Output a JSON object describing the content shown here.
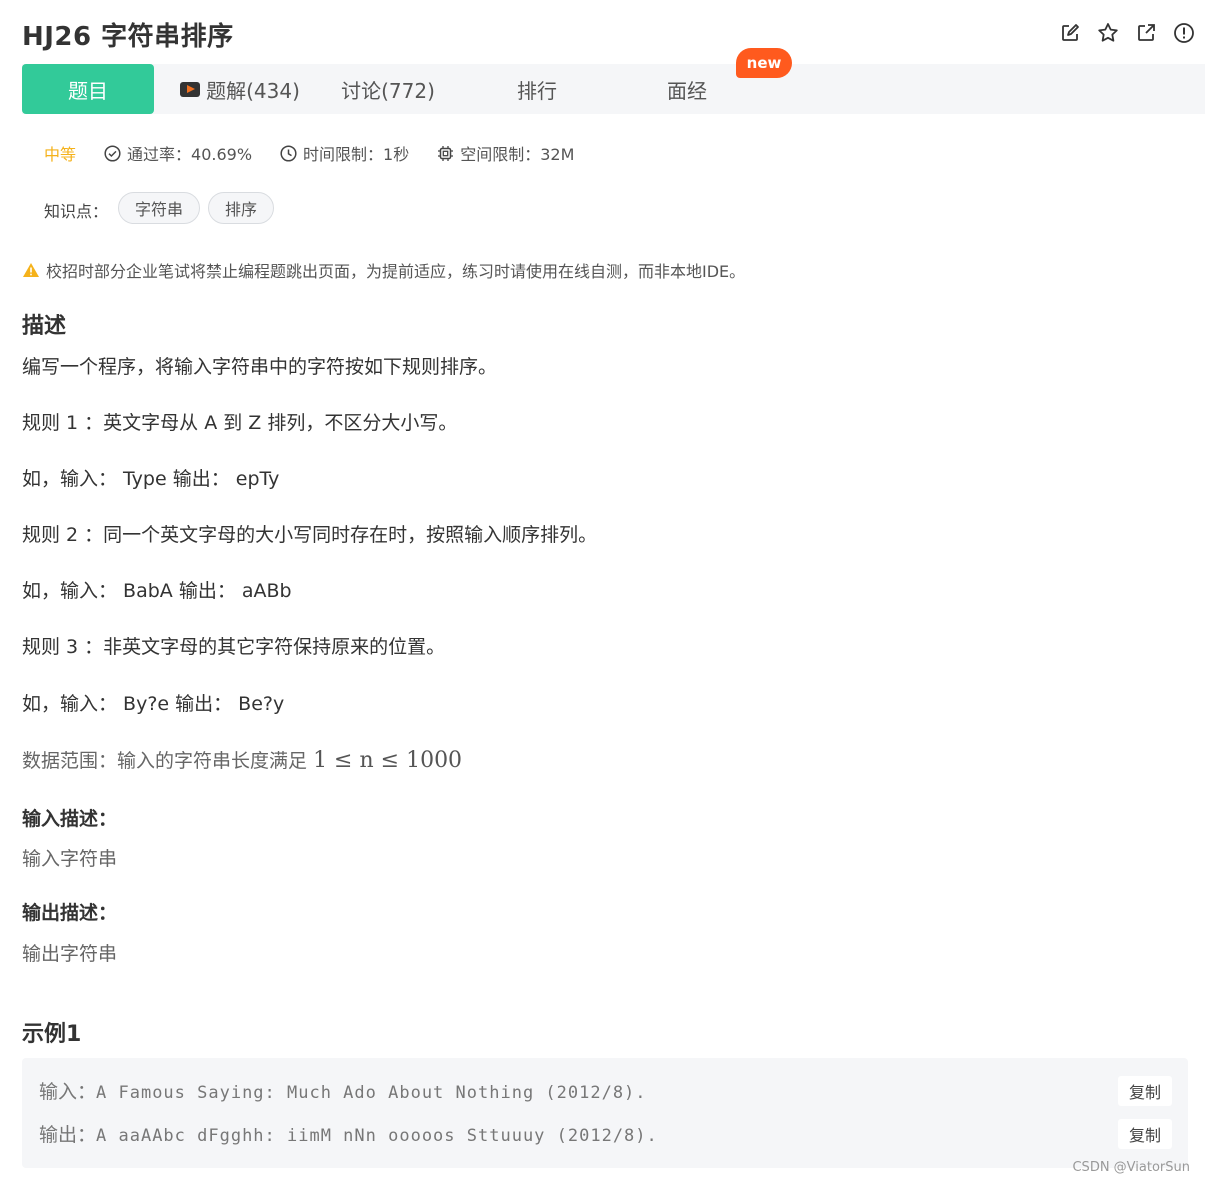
{
  "header": {
    "title": "HJ26  字符串排序",
    "actions": [
      "edit-icon",
      "star-icon",
      "external-link-icon",
      "info-icon"
    ]
  },
  "tabs": [
    {
      "label": "题目"
    },
    {
      "label": "题解(434)"
    },
    {
      "label": "讨论(772)"
    },
    {
      "label": "排行"
    },
    {
      "label": "面经"
    }
  ],
  "new_badge": "new",
  "meta": {
    "difficulty": "中等",
    "pass_rate": "通过率：40.69%",
    "time_limit": "时间限制：1秒",
    "space_limit": "空间限制：32M"
  },
  "knowledge": {
    "label": "知识点：",
    "tags": [
      "字符串",
      "排序"
    ]
  },
  "warning": "校招时部分企业笔试将禁止编程题跳出页面，为提前适应，练习时请使用在线自测，而非本地IDE。",
  "description": {
    "heading": "描述",
    "paragraphs": [
      "编写一个程序，将输入字符串中的字符按如下规则排序。",
      "规则 1 ：英文字母从 A 到 Z 排列，不区分大小写。",
      "如，输入： Type 输出： epTy",
      "规则 2 ：同一个英文字母的大小写同时存在时，按照输入顺序排列。",
      "如，输入： BabA 输出： aABb",
      "规则 3 ：非英文字母的其它字符保持原来的位置。",
      "如，输入： By?e 输出： Be?y"
    ],
    "range_prefix": "数据范围：输入的字符串长度满足",
    "range_math": "1 ≤ n ≤ 1000"
  },
  "input_desc": {
    "heading": "输入描述：",
    "text": "输入字符串"
  },
  "output_desc": {
    "heading": "输出描述：",
    "text": "输出字符串"
  },
  "example": {
    "heading": "示例1",
    "input_label": "输入：",
    "input_value": "A Famous Saying: Much Ado About Nothing (2012/8).",
    "output_label": "输出：",
    "output_value": "A aaAAbc dFgghh: iimM nNn ooooos Sttuuuy (2012/8).",
    "copy_label": "复制"
  },
  "watermark": "CSDN @ViatorSun",
  "colors": {
    "accent": "#32ca99",
    "difficulty": "#f5b21b",
    "new_badge": "#ff5a1e",
    "warning": "#f5b21b"
  }
}
